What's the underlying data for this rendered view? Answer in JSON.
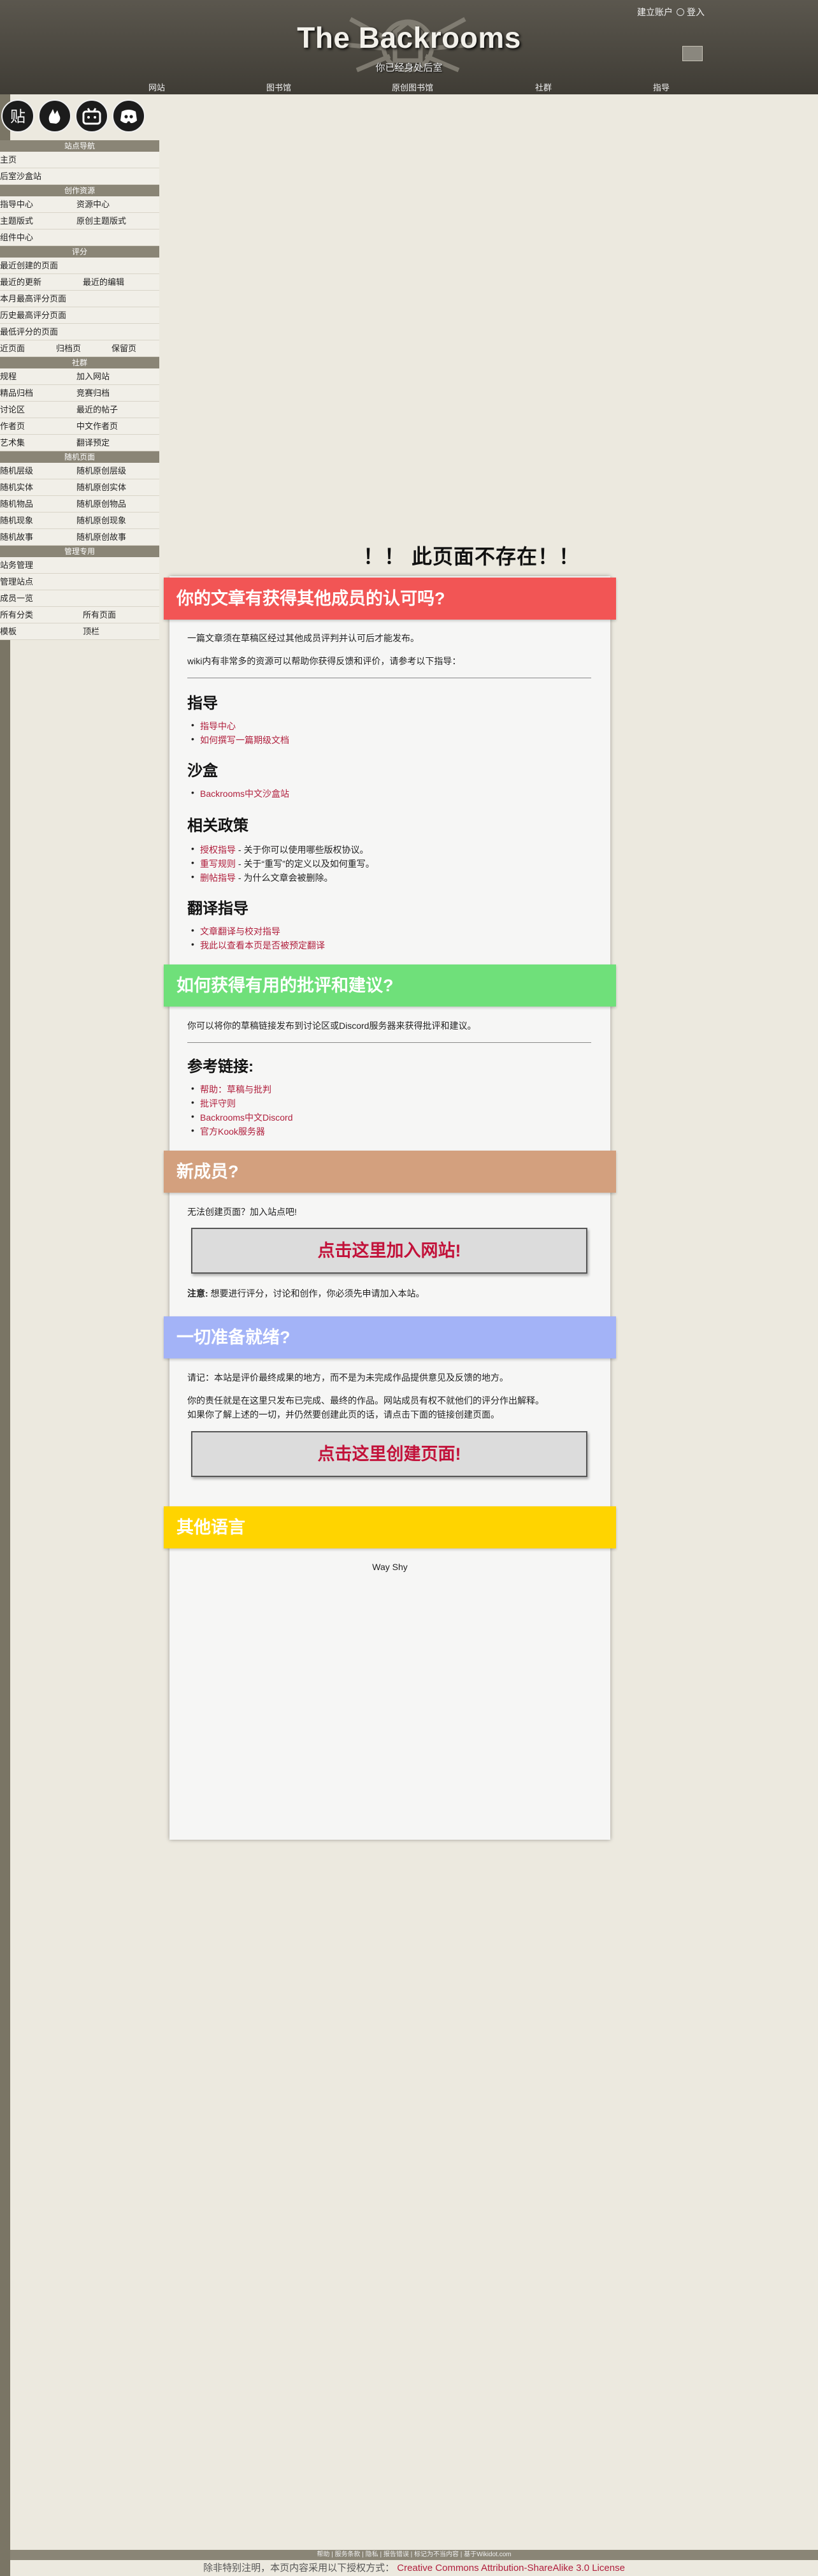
{
  "header": {
    "title": "The Backrooms",
    "subtitle": "你已经身处后室",
    "account": {
      "create": "建立账户",
      "login": "登入"
    },
    "nav": [
      "网站",
      "图书馆",
      "原创图书馆",
      "社群",
      "指导"
    ]
  },
  "sidebar": {
    "social": [
      "贴-icon",
      "hand-icon",
      "bilibili-icon",
      "discord-icon"
    ],
    "sections": [
      {
        "head": "站点导航",
        "rows": [
          [
            "主页"
          ],
          [
            "后室沙盒站"
          ]
        ]
      },
      {
        "head": "创作资源",
        "rows": [
          [
            "指导中心",
            "资源中心"
          ],
          [
            "主题版式",
            "原创主题版式"
          ],
          [
            "组件中心"
          ]
        ]
      },
      {
        "head": "评分",
        "rows": [
          [
            "最近创建的页面"
          ],
          [
            "最近的更新",
            "最近的编辑"
          ],
          [
            "本月最高评分页面"
          ],
          [
            "历史最高评分页面"
          ],
          [
            "最低评分的页面"
          ],
          [
            "近页面",
            "归档页",
            "保留页"
          ]
        ]
      },
      {
        "head": "社群",
        "rows": [
          [
            "规程",
            "加入网站"
          ],
          [
            "精品归档",
            "竞赛归档"
          ],
          [
            "讨论区",
            "最近的帖子"
          ],
          [
            "作者页",
            "中文作者页"
          ],
          [
            "艺术集",
            "翻译预定"
          ]
        ]
      },
      {
        "head": "随机页面",
        "rows": [
          [
            "随机层级",
            "随机原创层级"
          ],
          [
            "随机实体",
            "随机原创实体"
          ],
          [
            "随机物品",
            "随机原创物品"
          ],
          [
            "随机现象",
            "随机原创现象"
          ],
          [
            "随机故事",
            "随机原创故事"
          ]
        ]
      },
      {
        "head": "管理专用",
        "rows": [
          [
            "站务管理"
          ],
          [
            "管理站点"
          ],
          [
            "成员一览"
          ],
          [
            "所有分类",
            "所有页面"
          ],
          [
            "模板",
            "顶栏"
          ]
        ]
      }
    ]
  },
  "main": {
    "heading": "！！ 此页面不存在！！",
    "s1": {
      "title": "你的文章有获得其他成员的认可吗?",
      "color": "#f25555",
      "p1": "一篇文章须在草稿区经过其他成员评判并认可后才能发布。",
      "p2": "wiki内有非常多的资源可以帮助你获得反馈和评价，请参考以下指导：",
      "guide": {
        "h": "指导",
        "links": [
          "指导中心",
          "如何撰写一篇期级文档"
        ]
      },
      "sandbox": {
        "h": "沙盒",
        "links": [
          "Backrooms中文沙盒站"
        ]
      },
      "policy": {
        "h": "相关政策",
        "items": [
          {
            "link": "授权指导",
            "desc": " - 关于你可以使用哪些版权协议。"
          },
          {
            "link": "重写规则",
            "desc": " - 关于“重写”的定义以及如何重写。"
          },
          {
            "link": "删帖指导",
            "desc": " - 为什么文章会被删除。"
          }
        ]
      },
      "translate": {
        "h": "翻译指导",
        "links": [
          "文章翻译与校对指导",
          "我此以查看本页是否被预定翻译"
        ]
      }
    },
    "s2": {
      "title": "如何获得有用的批评和建议?",
      "color": "#6fe07a",
      "p1": "你可以将你的草稿链接发布到讨论区或Discord服务器来获得批评和建议。",
      "refs": {
        "h": "参考链接:",
        "links": [
          "帮助：草稿与批判",
          "批评守则",
          "Backrooms中文Discord",
          "官方Kook服务器"
        ]
      }
    },
    "s3": {
      "title": "新成员?",
      "color": "#d3a07e",
      "p1": "无法创建页面？加入站点吧!",
      "button": "点击这里加入网站!",
      "note_bold": "注意:",
      "note": " 想要进行评分，讨论和创作，你必须先申请加入本站。"
    },
    "s4": {
      "title": "一切准备就绪?",
      "color": "#a3b3f7",
      "p1": "请记：本站是评价最终成果的地方，而不是为未完成作品提供意见及反馈的地方。",
      "p2": "你的责任就是在这里只发布已完成、最终的作品。网站成员有权不就他们的评分作出解释。",
      "p3": "如果你了解上述的一切，并仍然要创建此页的话，请点击下面的链接创建页面。",
      "button": "点击这里创建页面!"
    },
    "s5": {
      "title": "其他语言",
      "color": "#ffd400",
      "text": "Way Shy"
    }
  },
  "footer": {
    "bar": "帮助 | 服务条款 | 隐私 | 报告错误 | 标记为不当内容 | 基于Wikidot.com",
    "license_prefix": "除非特别注明，本页内容采用以下授权方式：",
    "license_link": "Creative Commons Attribution-ShareAlike 3.0 License"
  }
}
